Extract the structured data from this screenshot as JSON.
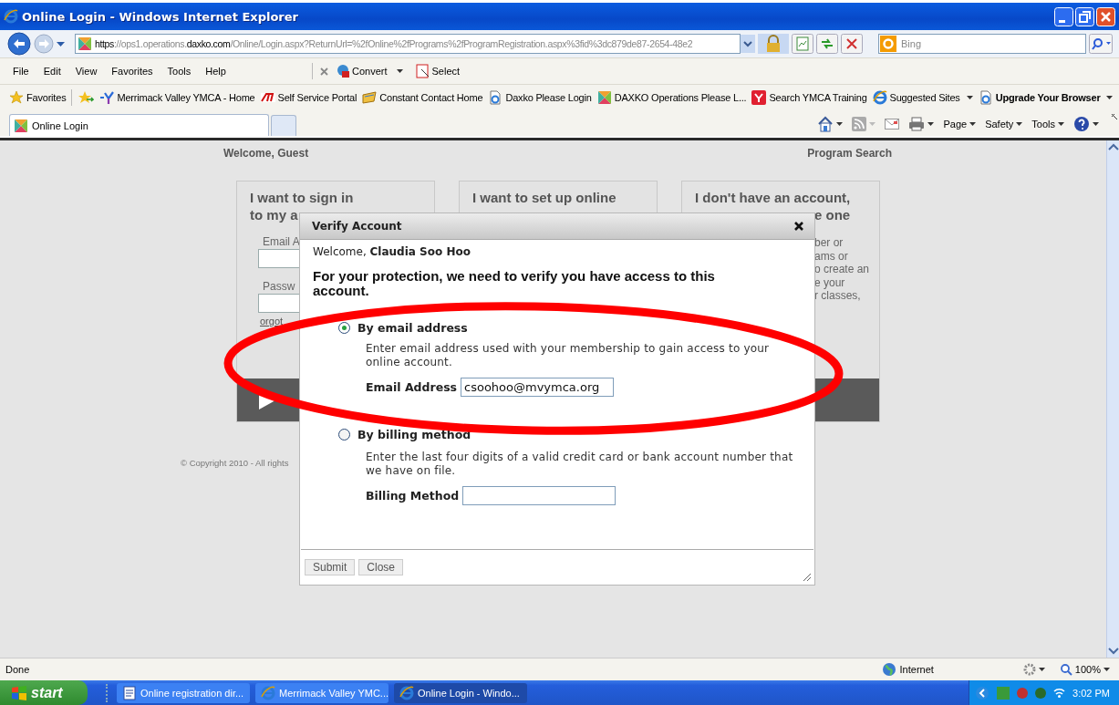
{
  "window": {
    "title": "Online Login - Windows Internet Explorer"
  },
  "address_bar": {
    "url": "**https**://ops1.operations.**daxko.com**/Online/Login.aspx?ReturnUrl=%2fOnline%2fPrograms%2fProgramRegistration.aspx%3fid%3dc879de87-2654-48e2",
    "search_placeholder": "Bing"
  },
  "menu": [
    "File",
    "Edit",
    "View",
    "Favorites",
    "Tools",
    "Help"
  ],
  "toolbar": [
    {
      "label": "Convert",
      "kind": "convert"
    },
    {
      "label": "Select",
      "kind": "select"
    }
  ],
  "favorites": {
    "label": "Favorites",
    "items": [
      {
        "label": "Merrimack Valley YMCA - Home",
        "kind": "ymca",
        "bold": false,
        "menu": false
      },
      {
        "label": "Self Service Portal",
        "kind": "adp",
        "bold": false,
        "menu": false
      },
      {
        "label": "Constant Contact  Home",
        "kind": "contact",
        "bold": false,
        "menu": false
      },
      {
        "label": "Daxko  Please Login",
        "kind": "page",
        "bold": false,
        "menu": false
      },
      {
        "label": "DAXKO Operations  Please L...",
        "kind": "daxko",
        "bold": false,
        "menu": false
      },
      {
        "label": "Search YMCA Training",
        "kind": "ymca-red",
        "bold": false,
        "menu": false
      },
      {
        "label": "Suggested Sites",
        "kind": "ie",
        "bold": false,
        "menu": true
      },
      {
        "label": "Upgrade Your Browser",
        "kind": "page",
        "bold": true,
        "menu": true
      }
    ]
  },
  "tabs": [
    {
      "label": "Online Login",
      "selected": true
    }
  ],
  "command_bar": [
    "Page",
    "Safety",
    "Tools"
  ],
  "page": {
    "welcome": "Welcome, Guest",
    "link": "Program Search",
    "cards": [
      {
        "kind": "signin",
        "title_lines": [
          "I want to sign in",
          "to my a"
        ],
        "fields": [
          "Email A",
          "Passw"
        ],
        "link": "orgot"
      },
      {
        "kind": "setup",
        "title_lines": [
          "I want to set up online"
        ]
      },
      {
        "kind": "create",
        "title_lines": [
          "I don't have an account,",
          "e one"
        ],
        "lines": [
          "ber or",
          "ams or",
          "o create an",
          "e your",
          "r classes,"
        ]
      }
    ],
    "copyright": "© Copyright 2010 - All rights"
  },
  "dialog": {
    "title": "Verify Account",
    "welcome": "Welcome,",
    "user": "Claudia Soo Hoo",
    "heading": "For your protection, we need to verify you have access to this account.",
    "options": [
      {
        "label": "By email address",
        "selected": true,
        "description": "Enter email address used with your membership to gain access to your online account.",
        "field_label": "Email Address",
        "value": "csoohoo@mvymca.org"
      },
      {
        "label": "By billing method",
        "selected": false,
        "description": "Enter the last four digits of a valid credit card or bank account number that we have on file.",
        "field_label": "Billing Method"
      }
    ],
    "buttons": [
      "Submit",
      "Close"
    ]
  },
  "status_bar": {
    "text": "Done",
    "zone": "Internet",
    "zoom": "100%"
  },
  "taskbar": {
    "start": "start",
    "tasks": [
      {
        "label": "Online registration dir...",
        "kind": "doc",
        "selected": false
      },
      {
        "label": "Merrimack Valley YMC...",
        "kind": "ie",
        "selected": false
      },
      {
        "label": "Online Login - Windo...",
        "kind": "ie",
        "selected": true
      }
    ],
    "clock": "3:02 PM"
  }
}
